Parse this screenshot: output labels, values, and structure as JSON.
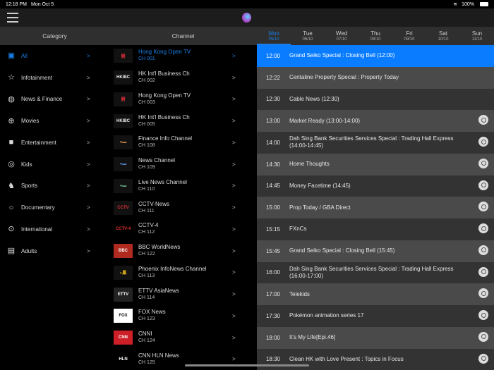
{
  "status": {
    "time": "12:18 PM",
    "date": "Mon Oct 5",
    "battery": "100%"
  },
  "header": {
    "category": "Category",
    "channel": "Channel"
  },
  "days": [
    {
      "d": "Mon",
      "dt": "05/10"
    },
    {
      "d": "Tue",
      "dt": "06/10"
    },
    {
      "d": "Wed",
      "dt": "07/10"
    },
    {
      "d": "Thu",
      "dt": "08/10"
    },
    {
      "d": "Fri",
      "dt": "09/10"
    },
    {
      "d": "Sat",
      "dt": "10/10"
    },
    {
      "d": "Sun",
      "dt": "11/10"
    }
  ],
  "categories": [
    {
      "label": "All",
      "icon": "all-icon",
      "g": "▣"
    },
    {
      "label": "Infotainment",
      "icon": "tv-star-icon",
      "g": "☆"
    },
    {
      "label": "News & Finance",
      "icon": "globe-icon",
      "g": "◍"
    },
    {
      "label": "Movies",
      "icon": "film-reel-icon",
      "g": "⊕"
    },
    {
      "label": "Entertainment",
      "icon": "entertainment-icon",
      "g": "■"
    },
    {
      "label": "Kids",
      "icon": "lollipop-icon",
      "g": "◎"
    },
    {
      "label": "Sports",
      "icon": "horse-icon",
      "g": "♞"
    },
    {
      "label": "Documentary",
      "icon": "documentary-icon",
      "g": "○"
    },
    {
      "label": "International",
      "icon": "microphone-icon",
      "g": "⊙"
    },
    {
      "label": "Adults",
      "icon": "clapperboard-icon",
      "g": "▤"
    }
  ],
  "channels": [
    {
      "name": "Hong Kong Open TV",
      "no": "CH 001",
      "logo": "開",
      "bg": "#111",
      "fg": "#e0303a"
    },
    {
      "name": "HK Int'l Business Ch",
      "no": "CH 002",
      "logo": "HKIBC",
      "bg": "#111",
      "fg": "#eee"
    },
    {
      "name": "Hong Kong Open TV",
      "no": "CH 003",
      "logo": "開",
      "bg": "#111",
      "fg": "#e0303a"
    },
    {
      "name": "HK Int'l Business Ch",
      "no": "CH 005",
      "logo": "HKIBC",
      "bg": "#111",
      "fg": "#eee"
    },
    {
      "name": "Finance Info Channel",
      "no": "CH 108",
      "logo": "●▬",
      "bg": "#111",
      "fg": "#c08040"
    },
    {
      "name": "News Channel",
      "no": "CH 109",
      "logo": "●▬",
      "bg": "#111",
      "fg": "#5080c0"
    },
    {
      "name": "Live News Channel",
      "no": "CH 110",
      "logo": "●▬",
      "bg": "#111",
      "fg": "#60a080"
    },
    {
      "name": "CCTV-News",
      "no": "CH 111",
      "logo": "CCTV",
      "bg": "#111",
      "fg": "#e03030"
    },
    {
      "name": "CCTV-4",
      "no": "CH 112",
      "logo": "CCTV-4",
      "bg": "#000",
      "fg": "#e03030"
    },
    {
      "name": "BBC WorldNews",
      "no": "CH 122",
      "logo": "BBC",
      "bg": "#b02a20",
      "fg": "#fff"
    },
    {
      "name": "Phoenix  InfoNews Channel",
      "no": "CH 113",
      "logo": "◐鳳",
      "bg": "#111",
      "fg": "#f0c020"
    },
    {
      "name": "ETTV AsiaNews",
      "no": "CH 114",
      "logo": "ETTV",
      "bg": "#222",
      "fg": "#fff"
    },
    {
      "name": "FOX News",
      "no": "CH 123",
      "logo": "FOX",
      "bg": "#fff",
      "fg": "#111"
    },
    {
      "name": "CNNI",
      "no": "CH 124",
      "logo": "CNN",
      "bg": "#cc1f27",
      "fg": "#fff"
    },
    {
      "name": "CNN HLN News",
      "no": "CH 125",
      "logo": "HLN",
      "bg": "#000",
      "fg": "#fff"
    }
  ],
  "programs": [
    {
      "time": "12:00",
      "title": "Grand Seiko Special : Closing Bell (12:00)",
      "alarm": false
    },
    {
      "time": "12:22",
      "title": "Centaline Property Special : Property Today",
      "alarm": false
    },
    {
      "time": "12:30",
      "title": "Cable News (12:30)",
      "alarm": false
    },
    {
      "time": "13:00",
      "title": "Market Ready (13:00-14:00)",
      "alarm": true
    },
    {
      "time": "14:00",
      "title": "Dah Sing Bank Securities Services Special : Trading Hall Express (14:00-14:45)",
      "alarm": true
    },
    {
      "time": "14:30",
      "title": "Home Thoughts",
      "alarm": true
    },
    {
      "time": "14:45",
      "title": "Money Facetime (14:45)",
      "alarm": true
    },
    {
      "time": "15:00",
      "title": "Prop Today / GBA Direct",
      "alarm": true
    },
    {
      "time": "15:15",
      "title": "FXnCs",
      "alarm": true
    },
    {
      "time": "15:45",
      "title": "Grand Seiko Special : Closing Bell (15:45)",
      "alarm": true
    },
    {
      "time": "16:00",
      "title": "Dah Sing Bank Securities Services Special : Trading Hall Express (16:00-17:00)",
      "alarm": true
    },
    {
      "time": "17:00",
      "title": "Telekids",
      "alarm": true
    },
    {
      "time": "17:30",
      "title": "Pokémon animation series 17",
      "alarm": true
    },
    {
      "time": "18:00",
      "title": "It's My Life[Epi.46]",
      "alarm": true
    },
    {
      "time": "18:30",
      "title": "Clean HK with Love Present : Topics in Focus",
      "alarm": true
    }
  ],
  "chevron": ">",
  "accent": "#1a7fe8"
}
